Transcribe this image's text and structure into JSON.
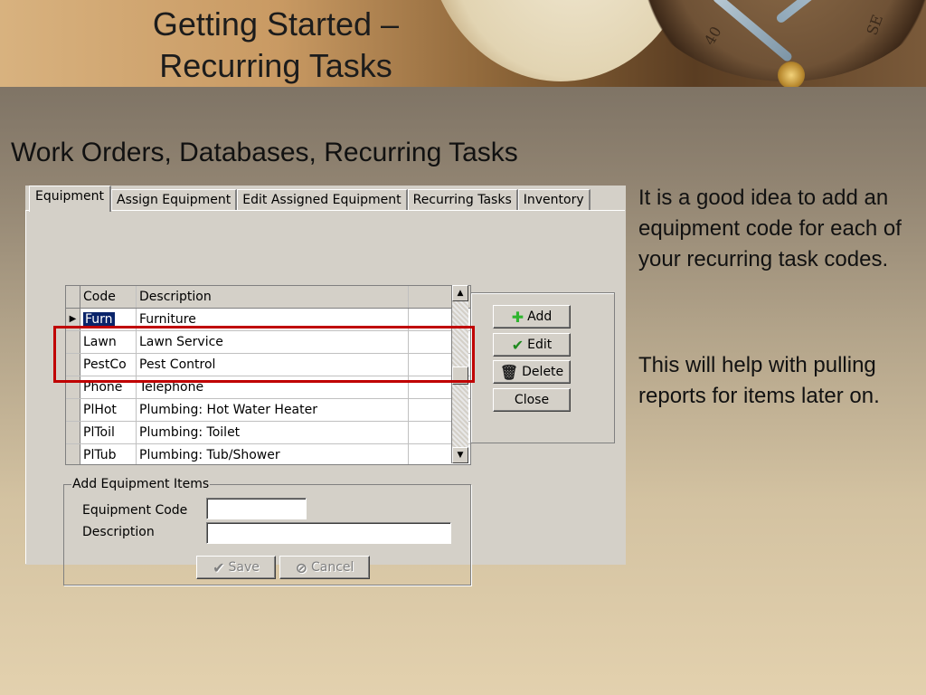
{
  "slide": {
    "title_line1": "Getting Started –",
    "title_line2": "Recurring Tasks",
    "subtitle": "Work Orders, Databases, Recurring Tasks",
    "paragraph1": "It is a good idea to add an equipment code for each of your recurring task codes.",
    "paragraph2": "This will help with pulling reports for items later on."
  },
  "banner_marks": [
    "40",
    "SE"
  ],
  "dialog": {
    "tabs": [
      {
        "label": "Equipment",
        "active": true
      },
      {
        "label": "Assign Equipment",
        "active": false
      },
      {
        "label": "Edit Assigned Equipment",
        "active": false
      },
      {
        "label": "Recurring Tasks",
        "active": false
      },
      {
        "label": "Inventory",
        "active": false
      }
    ],
    "grid": {
      "columns": [
        "Code",
        "Description"
      ],
      "rows": [
        {
          "code": "Furn",
          "description": "Furniture",
          "selected": true
        },
        {
          "code": "Lawn",
          "description": "Lawn Service",
          "selected": false
        },
        {
          "code": "PestCo",
          "description": "Pest Control",
          "selected": false
        },
        {
          "code": "Phone",
          "description": "Telephone",
          "selected": false
        },
        {
          "code": "PlHot",
          "description": "Plumbing: Hot Water Heater",
          "selected": false
        },
        {
          "code": "PlToil",
          "description": "Plumbing: Toilet",
          "selected": false
        },
        {
          "code": "PlTub",
          "description": "Plumbing: Tub/Shower",
          "selected": false
        }
      ]
    },
    "buttons": {
      "add": "Add",
      "edit": "Edit",
      "delete": "Delete",
      "close": "Close"
    },
    "add_group": {
      "legend": "Add Equipment Items",
      "code_label": "Equipment Code",
      "code_value": "",
      "description_label": "Description",
      "description_value": "",
      "save": "Save",
      "cancel": "Cancel"
    }
  },
  "colors": {
    "highlight_box": "#c00000",
    "selection": "#0a246a",
    "add_icon": "#2fb52f",
    "edit_icon": "#1f8a1f"
  }
}
